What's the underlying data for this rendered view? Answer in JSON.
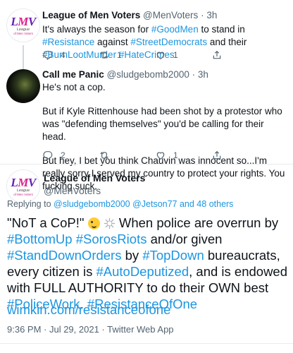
{
  "tweets": [
    {
      "name": "League of Men Voters",
      "handle": "@MenVoters",
      "dot": "·",
      "time": "3h",
      "avatar_logo": {
        "big_l": "L",
        "big_m": "M",
        "big_v": "V",
        "small": "League",
        "tiny": "of Men Voters"
      },
      "segments": [
        {
          "t": "It's always the season for ",
          "link": false
        },
        {
          "t": "#GoodMen",
          "link": true
        },
        {
          "t": " to stand in ",
          "link": false
        },
        {
          "t": "#Resistance",
          "link": true
        },
        {
          "t": " against ",
          "link": false
        },
        {
          "t": "#StreetDemocrats",
          "link": true
        },
        {
          "t": " and their ",
          "link": false
        },
        {
          "t": "#BurnLootMurder",
          "link": true
        },
        {
          "t": " ",
          "link": false
        },
        {
          "t": "#HateCrimes",
          "link": true
        },
        {
          "t": ".",
          "link": false
        }
      ],
      "replies": "4",
      "retweets": "1",
      "likes": "1",
      "share": ""
    },
    {
      "name": "Call me Panic",
      "handle": "@sludgebomb2000",
      "dot": "·",
      "time": "3h",
      "paragraphs": [
        "He's not a cop.",
        "But if Kyle Rittenhouse had been shot by a protestor who was \"defending themselves\" you'd be calling for their head.",
        "But hey, I bet you think Chauvin was innocent so...I'm really sorry I served my country to protect your rights.  You fucking suck."
      ],
      "replies": "2",
      "retweets": "",
      "likes": "1",
      "share": ""
    }
  ],
  "main_tweet": {
    "name": "League of Men Voters",
    "handle": "@MenVoters",
    "replying_prefix": "Replying to ",
    "replying_link": "@sludgebomb2000 @Jetson77 and 48 others",
    "segments_1": [
      {
        "t": "\"NoT a CoP!\" ",
        "link": false
      }
    ],
    "segments_2": [
      {
        "t": "  When police are overrun by ",
        "link": false
      },
      {
        "t": "#BottomUp",
        "link": true
      },
      {
        "t": " ",
        "link": false
      },
      {
        "t": "#SorosRiots",
        "link": true
      },
      {
        "t": " and/or given ",
        "link": false
      },
      {
        "t": "#StandDownOrders",
        "link": true
      },
      {
        "t": " by ",
        "link": false
      },
      {
        "t": "#TopDown",
        "link": true
      },
      {
        "t": " bureaucrats, every citizen is ",
        "link": false
      },
      {
        "t": "#AutoDeputized",
        "link": true
      },
      {
        "t": ", and is endowed with FULL AUTHORITY to do their OWN best ",
        "link": false
      },
      {
        "t": "#PoliceWork",
        "link": true
      },
      {
        "t": ". ",
        "link": false
      },
      {
        "t": "#ResistanceOfOne",
        "link": true
      }
    ],
    "url": "wimkin.com/resistanceofone",
    "timestamp": "9:36 PM · Jul 29, 2021 · Twitter Web App"
  },
  "colors": {
    "link": "#1b95e0",
    "muted": "#536471",
    "divider": "#e6ecf0"
  }
}
